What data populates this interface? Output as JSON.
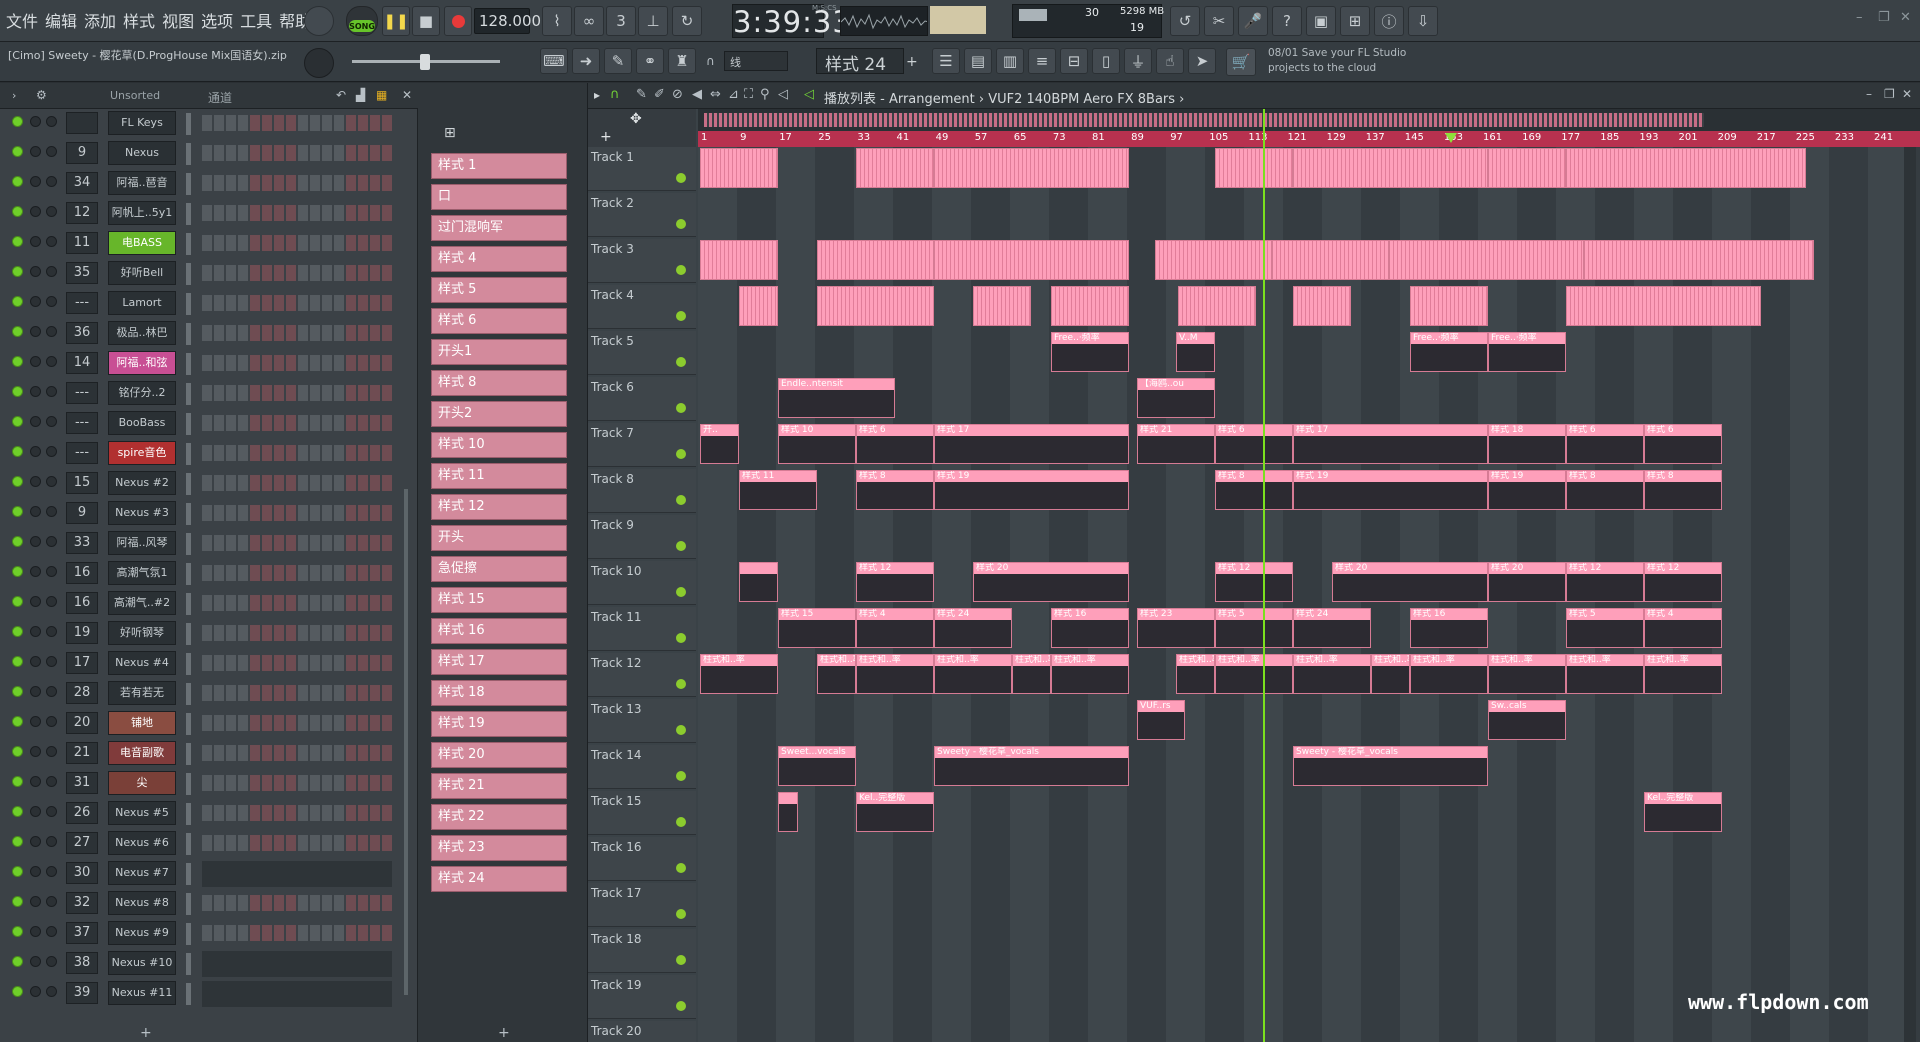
{
  "menu": [
    "文件",
    "编辑",
    "添加",
    "样式",
    "视图",
    "选项",
    "工具",
    "帮助"
  ],
  "transport": {
    "song_label": "SONG",
    "tempo": "128.000",
    "time": "3:39:33",
    "time_unit": "M:S:CS"
  },
  "cpu": {
    "cpu_value": "30",
    "memory": "5298 MB",
    "polyphony": "19"
  },
  "project": {
    "name": "[Cimo] Sweety - 樱花草(D.ProgHouse Mix国语女).zip"
  },
  "toolbar2": {
    "snap": "线",
    "pattern": "样式 24"
  },
  "news": {
    "date": "08/01",
    "text": "Save your FL Studio projects to the cloud"
  },
  "rack": {
    "filter": "Unsorted",
    "group": "通道"
  },
  "channels": [
    {
      "num": "",
      "name": "FL Keys"
    },
    {
      "num": "9",
      "name": "Nexus"
    },
    {
      "num": "34",
      "name": "阿福..琶音"
    },
    {
      "num": "12",
      "name": "阿帆上..5y1"
    },
    {
      "num": "11",
      "name": "电BASS"
    },
    {
      "num": "35",
      "name": "好听Bell"
    },
    {
      "num": "---",
      "name": "Lamort"
    },
    {
      "num": "36",
      "name": "极品..林巴"
    },
    {
      "num": "14",
      "name": "阿福..和弦"
    },
    {
      "num": "---",
      "name": "铭仔分..2"
    },
    {
      "num": "---",
      "name": "BooBass"
    },
    {
      "num": "---",
      "name": "spire音色"
    },
    {
      "num": "15",
      "name": "Nexus #2"
    },
    {
      "num": "9",
      "name": "Nexus #3"
    },
    {
      "num": "33",
      "name": "阿福..风琴"
    },
    {
      "num": "16",
      "name": "高潮气氛1"
    },
    {
      "num": "16",
      "name": "高潮气..#2"
    },
    {
      "num": "19",
      "name": "好听钢琴"
    },
    {
      "num": "17",
      "name": "Nexus #4"
    },
    {
      "num": "28",
      "name": "若有若无"
    },
    {
      "num": "20",
      "name": "铺地"
    },
    {
      "num": "21",
      "name": "电音副歌"
    },
    {
      "num": "31",
      "name": "尖"
    },
    {
      "num": "26",
      "name": "Nexus #5"
    },
    {
      "num": "27",
      "name": "Nexus #6"
    },
    {
      "num": "30",
      "name": "Nexus #7"
    },
    {
      "num": "32",
      "name": "Nexus #8"
    },
    {
      "num": "37",
      "name": "Nexus #9"
    },
    {
      "num": "38",
      "name": "Nexus #10"
    },
    {
      "num": "39",
      "name": "Nexus #11"
    }
  ],
  "patterns": [
    "样式 1",
    "口",
    "过门混响军",
    "样式 4",
    "样式 5",
    "样式 6",
    "开头1",
    "样式 8",
    "开头2",
    "样式 10",
    "样式 11",
    "样式 12",
    "开头",
    "急促擦",
    "样式 15",
    "样式 16",
    "样式 17",
    "样式 18",
    "样式 19",
    "样式 20",
    "样式 21",
    "样式 22",
    "样式 23",
    "样式 24"
  ],
  "playlist": {
    "title": "播放列表 - Arrangement › VUF2 140BPM Aero FX 8Bars ›"
  },
  "bars": [
    "1",
    "9",
    "17",
    "25",
    "33",
    "41",
    "49",
    "57",
    "65",
    "73",
    "81",
    "89",
    "97",
    "105",
    "113",
    "121",
    "129",
    "137",
    "145",
    "153",
    "161",
    "169",
    "177",
    "185",
    "193",
    "201",
    "209",
    "217",
    "225",
    "233",
    "241"
  ],
  "tracks": [
    "Track 1",
    "Track 2",
    "Track 3",
    "Track 4",
    "Track 5",
    "Track 6",
    "Track 7",
    "Track 8",
    "Track 9",
    "Track 10",
    "Track 11",
    "Track 12",
    "Track 13",
    "Track 14",
    "Track 15",
    "Track 16",
    "Track 17",
    "Track 18",
    "Track 19",
    "Track 20"
  ],
  "clip_labels": {
    "t5": "Free..·频率",
    "t5b": "V..M",
    "t6a": "Endle..ntensit",
    "t6b": "【海鸥..ou",
    "t7a": "开..",
    "t7b": "样式 10",
    "t7c": "样式 6",
    "t7d": "样式 17",
    "t7e": "样式 21",
    "t7f": "样式 18",
    "t8a": "样式 11",
    "t8b": "样式 8",
    "t8c": "样式 19",
    "t10a": "样式 12",
    "t10b": "样式 20",
    "t11a": "样式 15",
    "t11b": "样式 4",
    "t11c": "样式 24",
    "t11d": "样式 16",
    "t11e": "样式 23",
    "t11f": "样式 5",
    "t12": "柱式和..率",
    "t13a": "VUF..rs",
    "t13b": "Sw..cals",
    "t14a": "Sweet...vocals",
    "t14b": "Sweety - 樱花草_vocals",
    "t15": "Kel..完整版"
  },
  "watermark": "www.flpdown.com",
  "colors": {
    "clip": "#fe9fba",
    "timeline": "#b8314f",
    "playhead": "#7be01f"
  }
}
